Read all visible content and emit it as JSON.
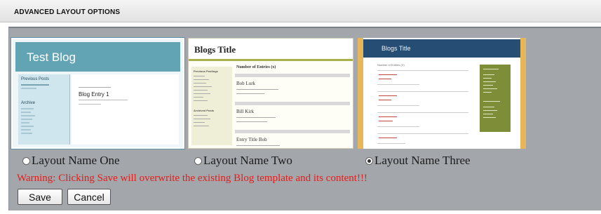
{
  "header": {
    "title": "ADVANCED LAYOUT OPTIONS"
  },
  "layouts": [
    {
      "name": "Layout Name One",
      "selected": false,
      "preview": {
        "blog_title": "Test Blog",
        "side_headings": [
          "Previous Posts",
          "Archive"
        ],
        "entry_title": "Blog Entry 1"
      }
    },
    {
      "name": "Layout Name Two",
      "selected": false,
      "preview": {
        "blog_title": "Blogs Title",
        "side_headings": [
          "Previous Postings",
          "Archived Posts"
        ],
        "main_heading": "Number of Entries (x)",
        "entry_titles": [
          "Bob Lurk",
          "Bill Kirk",
          "Entry Title Bob"
        ]
      }
    },
    {
      "name": "Layout Name Three",
      "selected": true,
      "preview": {
        "blog_title": "Blogs Title",
        "main_heading": "Number of Entries (X)"
      }
    }
  ],
  "warning": "Warning: Clicking Save will overwrite the existing Blog template and its content!!!",
  "buttons": {
    "save": "Save",
    "cancel": "Cancel"
  },
  "colors": {
    "panel": "#a3a6ab",
    "warning": "#e0201c",
    "thumb1_banner": "#63a4b4",
    "thumb3_banner": "#264e74",
    "thumb3_sidebar": "#7e8e38",
    "thumb3_frame": "#e7b659"
  }
}
